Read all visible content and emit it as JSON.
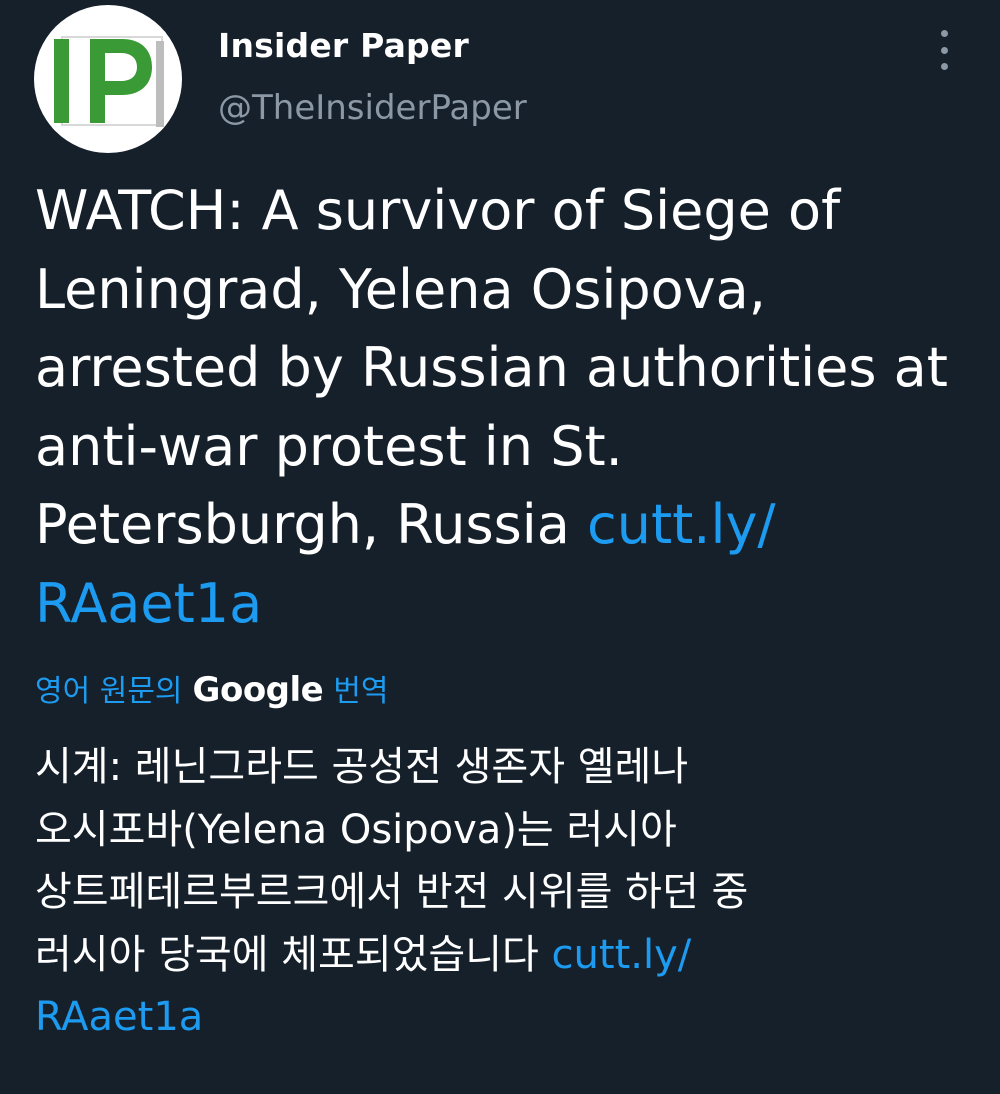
{
  "account": {
    "name": "Insider Paper",
    "handle": "@TheInsiderPaper",
    "avatar_logo_text": "IP",
    "avatar_logo_color": "#3a9a36"
  },
  "menu": {
    "icon": "more-vertical-icon"
  },
  "tweet": {
    "text_line1": "WATCH: A survivor of Siege of",
    "text_line2": "Leningrad, Yelena Osipova,",
    "text_line3": "arrested by Russian authorities at",
    "text_line4": "anti-war protest in St.",
    "text_line5": "Petersburgh, Russia ",
    "link_part1": "cutt.ly/",
    "link_part2": "RAaet1a"
  },
  "translation": {
    "prefix": "영어 원문의",
    "provider": "Google",
    "suffix": "번역",
    "text_line1": "시계: 레닌그라드 공성전 생존자 옐레나",
    "text_line2": "오시포바(Yelena Osipova)는 러시아",
    "text_line3": "상트페테르부르크에서 반전 시위를 하던 중",
    "text_line4": "러시아 당국에 체포되었습니다 ",
    "link_part1": "cutt.ly/",
    "link_part2": "RAaet1a"
  },
  "colors": {
    "background": "#15202b",
    "link": "#1d9bf0",
    "secondary_text": "#8b98a5"
  }
}
